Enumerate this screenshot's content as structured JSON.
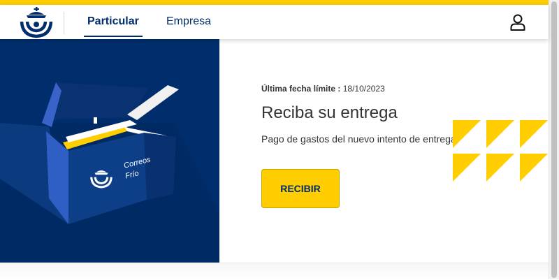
{
  "header": {
    "logo_icon": "correos-horn-crown-logo",
    "tabs": [
      {
        "label": "Particular",
        "active": true
      },
      {
        "label": "Empresa",
        "active": false
      }
    ],
    "user_icon": "user-icon"
  },
  "hero": {
    "image_icon": "correos-frio-open-box",
    "box_brand_line1": "Correos",
    "box_brand_line2": "Frío"
  },
  "content": {
    "deadline_label": "Última fecha límite :",
    "deadline_value": "18/10/2023",
    "title": "Reciba su entrega",
    "subtitle": "Pago de gastos del nuevo intento de entrega.",
    "button_label": "RECIBIR"
  },
  "colors": {
    "brand_yellow": "#ffcd00",
    "brand_blue": "#002e6d"
  }
}
